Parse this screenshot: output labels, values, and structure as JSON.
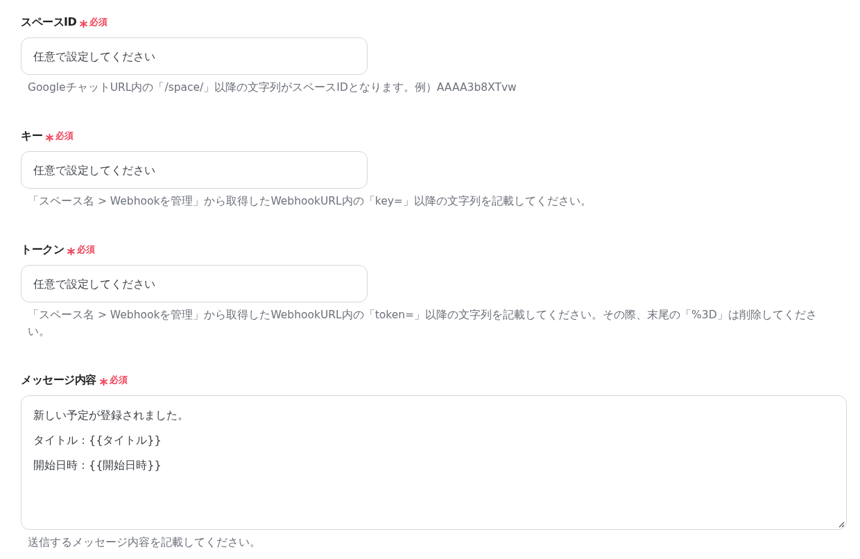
{
  "fields": [
    {
      "kind": "input",
      "label": "スペースID",
      "required": true,
      "required_text": "必須",
      "placeholder": "任意で設定してください",
      "hint": "GoogleチャットURL内の「/space/」以降の文字列がスペースIDとなります。例）AAAA3b8XTvw"
    },
    {
      "kind": "input",
      "label": "キー",
      "required": true,
      "required_text": "必須",
      "placeholder": "任意で設定してください",
      "hint": "「スペース名 > Webhookを管理」から取得したWebhookURL内の「key=」以降の文字列を記載してください。"
    },
    {
      "kind": "input",
      "label": "トークン",
      "required": true,
      "required_text": "必須",
      "placeholder": "任意で設定してください",
      "hint": "「スペース名 > Webhookを管理」から取得したWebhookURL内の「token=」以降の文字列を記載してください。その際、末尾の「%3D」は削除してください。"
    },
    {
      "kind": "textarea",
      "label": "メッセージ内容",
      "required": true,
      "required_text": "必須",
      "lines": [
        "新しい予定が登録されました。",
        "タイトル：{{タイトル}}",
        "開始日時：{{開始日時}}"
      ],
      "hint": "送信するメッセージ内容を記載してください。"
    }
  ]
}
